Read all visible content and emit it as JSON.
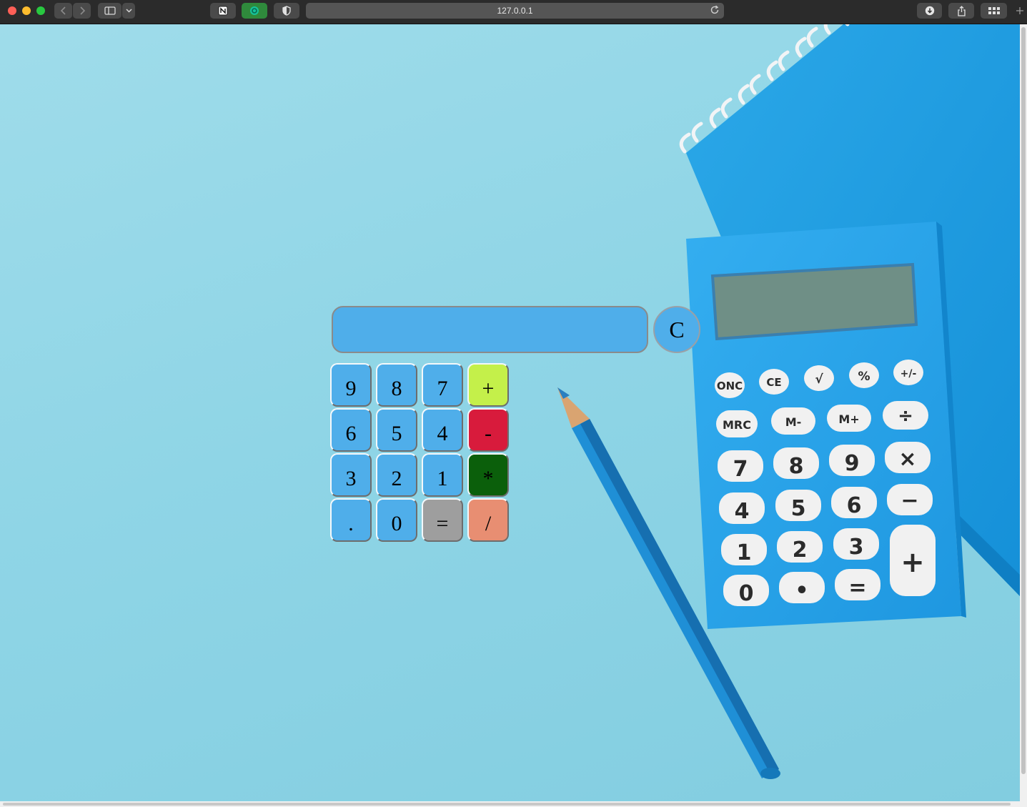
{
  "browser": {
    "url": "127.0.0.1",
    "traffic_lights": {
      "close": "#ff5f57",
      "minimize": "#febc2e",
      "zoom": "#28c840"
    }
  },
  "calculator": {
    "display_value": "",
    "clear_label": "C",
    "keys": [
      {
        "label": "9",
        "color": "#4faeea"
      },
      {
        "label": "8",
        "color": "#4faeea"
      },
      {
        "label": "7",
        "color": "#4faeea"
      },
      {
        "label": "+",
        "color": "#c4f04a"
      },
      {
        "label": "6",
        "color": "#4faeea"
      },
      {
        "label": "5",
        "color": "#4faeea"
      },
      {
        "label": "4",
        "color": "#4faeea"
      },
      {
        "label": "-",
        "color": "#d81b3c"
      },
      {
        "label": "3",
        "color": "#4faeea"
      },
      {
        "label": "2",
        "color": "#4faeea"
      },
      {
        "label": "1",
        "color": "#4faeea"
      },
      {
        "label": "*",
        "color": "#0b5f0b"
      },
      {
        "label": ".",
        "color": "#4faeea"
      },
      {
        "label": "0",
        "color": "#4faeea"
      },
      {
        "label": "=",
        "color": "#9e9e9e"
      },
      {
        "label": "/",
        "color": "#e88e72"
      }
    ]
  },
  "background_photo": {
    "calculator_keys": [
      "ONC",
      "CE",
      "√",
      "%",
      "+/-",
      "MRC",
      "M-",
      "M+",
      "÷",
      "7",
      "8",
      "9",
      "×",
      "4",
      "5",
      "6",
      "−",
      "1",
      "2",
      "3",
      "+",
      "0",
      "•",
      "="
    ]
  }
}
